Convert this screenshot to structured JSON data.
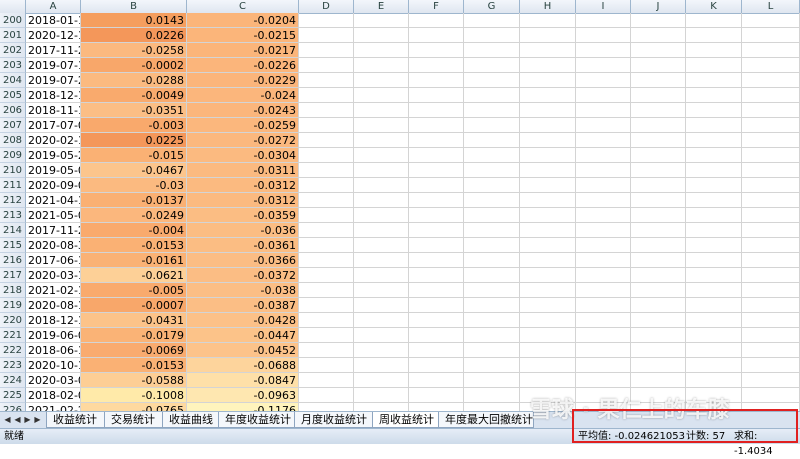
{
  "columns": [
    "A",
    "B",
    "C",
    "D",
    "E",
    "F",
    "G",
    "H",
    "I",
    "J",
    "K",
    "L"
  ],
  "rows": [
    {
      "r": "200",
      "a": "2018-01-1",
      "b": "0.0143",
      "c": "-0.0204",
      "bc": "#f59e5e",
      "cc": "#fbb57a"
    },
    {
      "r": "201",
      "a": "2020-12-1",
      "b": "0.0226",
      "c": "-0.0215",
      "bc": "#f4975a",
      "cc": "#fbb57a"
    },
    {
      "r": "202",
      "a": "2017-11-2",
      "b": "-0.0258",
      "c": "-0.0217",
      "bc": "#fbb97f",
      "cc": "#fbb57a"
    },
    {
      "r": "203",
      "a": "2019-07-1",
      "b": "-0.0002",
      "c": "-0.0226",
      "bc": "#f8a76a",
      "cc": "#fbb57b"
    },
    {
      "r": "204",
      "a": "2019-07-2",
      "b": "-0.0288",
      "c": "-0.0229",
      "bc": "#fbba80",
      "cc": "#fbb57b"
    },
    {
      "r": "205",
      "a": "2018-12-1",
      "b": "-0.0049",
      "c": "-0.024",
      "bc": "#f9aa6d",
      "cc": "#fbb67c"
    },
    {
      "r": "206",
      "a": "2018-11-1",
      "b": "-0.0351",
      "c": "-0.0243",
      "bc": "#fbbe85",
      "cc": "#fbb67c"
    },
    {
      "r": "207",
      "a": "2017-07-0",
      "b": "-0.003",
      "c": "-0.0259",
      "bc": "#f9a96c",
      "cc": "#fbb77d"
    },
    {
      "r": "208",
      "a": "2020-02-1",
      "b": "0.0225",
      "c": "-0.0272",
      "bc": "#f4975a",
      "cc": "#fbb87e"
    },
    {
      "r": "209",
      "a": "2019-05-2",
      "b": "-0.015",
      "c": "-0.0304",
      "bc": "#fab174",
      "cc": "#fbba80"
    },
    {
      "r": "210",
      "a": "2019-05-0",
      "b": "-0.0467",
      "c": "-0.0311",
      "bc": "#fcc58c",
      "cc": "#fbba80"
    },
    {
      "r": "211",
      "a": "2020-09-0",
      "b": "-0.03",
      "c": "-0.0312",
      "bc": "#fbba80",
      "cc": "#fbba80"
    },
    {
      "r": "212",
      "a": "2021-04-1",
      "b": "-0.0137",
      "c": "-0.0312",
      "bc": "#fab073",
      "cc": "#fbba80"
    },
    {
      "r": "213",
      "a": "2021-05-0",
      "b": "-0.0249",
      "c": "-0.0359",
      "bc": "#fbb77d",
      "cc": "#fbbd83"
    },
    {
      "r": "214",
      "a": "2017-11-2",
      "b": "-0.004",
      "c": "-0.036",
      "bc": "#f9aa6d",
      "cc": "#fbbd83"
    },
    {
      "r": "215",
      "a": "2020-08-3",
      "b": "-0.0153",
      "c": "-0.0361",
      "bc": "#fab174",
      "cc": "#fbbd83"
    },
    {
      "r": "216",
      "a": "2017-06-1",
      "b": "-0.0161",
      "c": "-0.0366",
      "bc": "#fab275",
      "cc": "#fbbd84"
    },
    {
      "r": "217",
      "a": "2020-03-1",
      "b": "-0.0621",
      "c": "-0.0372",
      "bc": "#fdd097",
      "cc": "#fbbd84"
    },
    {
      "r": "218",
      "a": "2021-02-1",
      "b": "-0.005",
      "c": "-0.038",
      "bc": "#f9aa6d",
      "cc": "#fbbe85"
    },
    {
      "r": "219",
      "a": "2020-08-1",
      "b": "-0.0007",
      "c": "-0.0387",
      "bc": "#f8a76a",
      "cc": "#fbbe85"
    },
    {
      "r": "220",
      "a": "2018-12-1",
      "b": "-0.0431",
      "c": "-0.0428",
      "bc": "#fcc389",
      "cc": "#fcc188"
    },
    {
      "r": "221",
      "a": "2019-06-0",
      "b": "-0.0179",
      "c": "-0.0447",
      "bc": "#fab376",
      "cc": "#fcc389"
    },
    {
      "r": "222",
      "a": "2018-06-1",
      "b": "-0.0069",
      "c": "-0.0452",
      "bc": "#f9ab6f",
      "cc": "#fcc38a"
    },
    {
      "r": "223",
      "a": "2020-10-1",
      "b": "-0.0153",
      "c": "-0.0688",
      "bc": "#fab174",
      "cc": "#fdd49c"
    },
    {
      "r": "224",
      "a": "2020-03-0",
      "b": "-0.0588",
      "c": "-0.0847",
      "bc": "#fdce95",
      "cc": "#fee0a8"
    },
    {
      "r": "225",
      "a": "2018-02-0",
      "b": "-0.1008",
      "c": "-0.0963",
      "bc": "#ffeaa9",
      "cc": "#fee7b0"
    },
    {
      "r": "226",
      "a": "2021-02-2",
      "b": "-0.0765",
      "c": "-0.1176",
      "bc": "#fed99f",
      "cc": "#fff4bd"
    },
    {
      "r": "227",
      "a": "",
      "b": "",
      "c": "",
      "bc": "#ffffff",
      "cc": "#ffffff"
    },
    {
      "r": "228",
      "a": "",
      "b": "",
      "c": "",
      "bc": "#ffffff",
      "cc": "#ffffff"
    }
  ],
  "sheet_tabs": [
    "收益统计",
    "交易统计",
    "收益曲线",
    "年度收益统计",
    "月度收益统计",
    "周收益统计",
    "年度最大回撤统计"
  ],
  "active_tab": "周收益统计",
  "status": {
    "ready": "就绪",
    "average": "平均值: -0.024621053",
    "count": "计数: 57",
    "sum": "求和: -1.4034"
  },
  "watermark": "雪球 · 果仁上的车膝",
  "colors": {
    "highlight_box": "#e02020"
  }
}
